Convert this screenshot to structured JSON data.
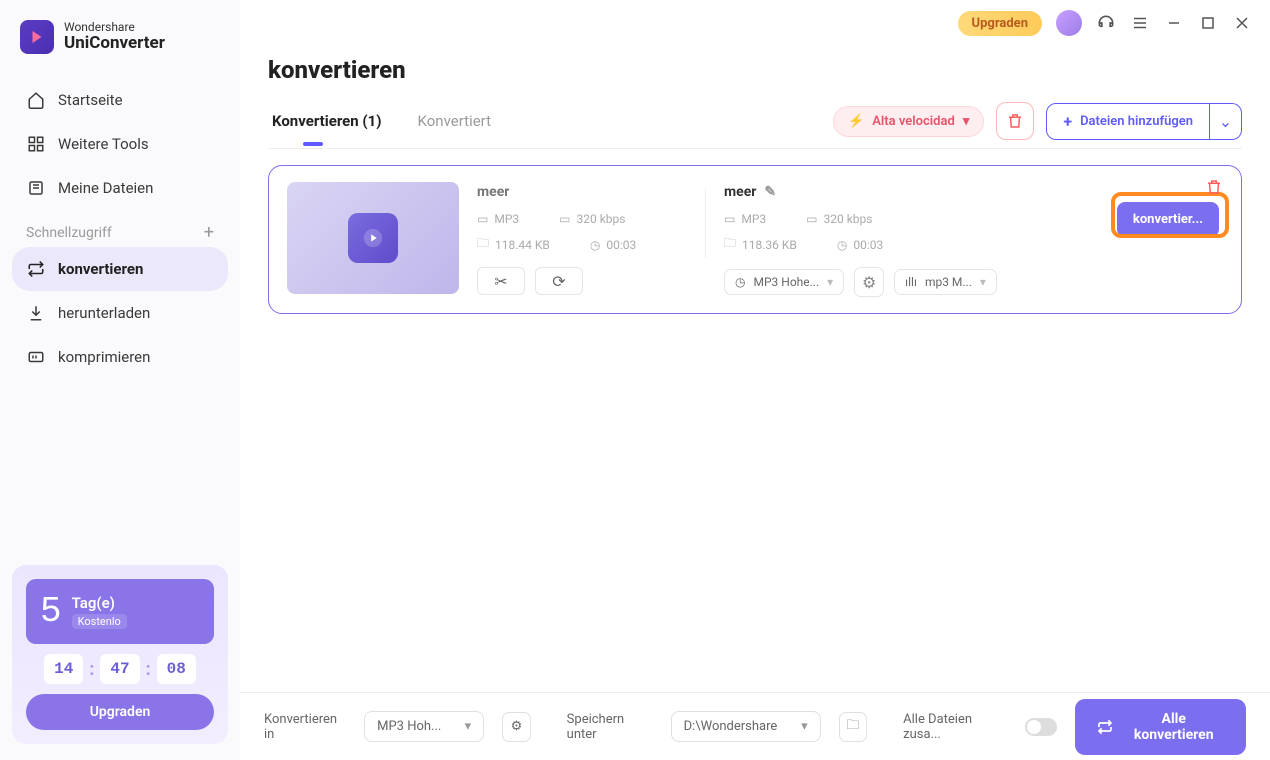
{
  "brand": {
    "line1": "Wondershare",
    "line2": "UniConverter"
  },
  "titlebar": {
    "upgrade": "Upgraden"
  },
  "nav": {
    "home": "Startseite",
    "tools": "Weitere Tools",
    "files": "Meine Dateien",
    "quick": "Schnellzugriff",
    "convert": "konvertieren",
    "download": "herunterladen",
    "compress": "komprimieren"
  },
  "promo": {
    "days": "5",
    "daylabel": "Tag(e)",
    "free": "Kostenlo",
    "h": "14",
    "m": "47",
    "s": "08",
    "btn": "Upgraden"
  },
  "page": {
    "title": "konvertieren"
  },
  "tabs": {
    "converting": "Konvertieren (1)",
    "converted": "Konvertiert"
  },
  "toolbar": {
    "speed": "Alta velocidad",
    "add": "Dateien hinzufügen"
  },
  "item": {
    "src": {
      "name": "meer",
      "fmt": "MP3",
      "bitrate": "320 kbps",
      "size": "118.44 KB",
      "dur": "00:03"
    },
    "dst": {
      "name": "meer",
      "fmt": "MP3",
      "bitrate": "320 kbps",
      "size": "118.36 KB",
      "dur": "00:03"
    },
    "preset": "MP3 Hohe...",
    "codec": "mp3 M...",
    "convert": "konvertier..."
  },
  "footer": {
    "convert_in": "Konvertieren in",
    "convert_in_val": "MP3 Hoh...",
    "save_under": "Speichern unter",
    "save_path": "D:\\Wondershare",
    "merge": "Alle Dateien zusa...",
    "all": "Alle konvertieren"
  }
}
